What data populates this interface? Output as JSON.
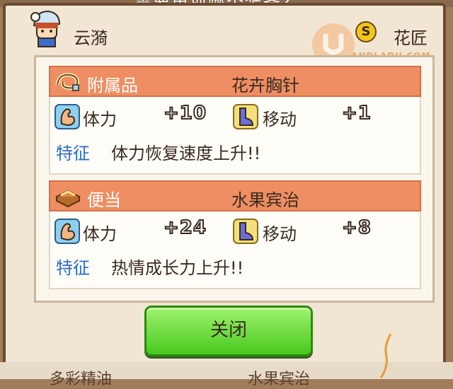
{
  "top_text": "需要更换哪个装备?",
  "character": {
    "name": "云漪",
    "skill_badge": "S",
    "skill": "花匠",
    "avatar_icon": "character-portrait-icon"
  },
  "watermark": {
    "text": "ANDLADU.COM",
    "icon": "u-logo-icon"
  },
  "items": [
    {
      "category": "附属品",
      "category_icon": "accessory-icon",
      "name": "花卉胸针",
      "stats": [
        {
          "label": "体力",
          "icon": "muscle-arm-icon",
          "value": "+10"
        },
        {
          "label": "移动",
          "icon": "boot-icon",
          "value": "+1"
        }
      ],
      "trait_label": "特征",
      "trait": "体力恢复速度上升!!"
    },
    {
      "category": "便当",
      "category_icon": "bento-icon",
      "name": "水果宾治",
      "stats": [
        {
          "label": "体力",
          "icon": "muscle-arm-icon",
          "value": "+24"
        },
        {
          "label": "移动",
          "icon": "boot-icon",
          "value": "+8"
        }
      ],
      "trait_label": "特征",
      "trait": "热情成长力上升!!"
    }
  ],
  "close_label": "关闭",
  "bottom_partial": [
    "多彩精油",
    "水果宾治"
  ],
  "colors": {
    "header_orange": "#ee8e62",
    "trait_blue": "#2b6cc7",
    "button_green": "#49c91f",
    "frame_brown": "#6b4a32"
  }
}
